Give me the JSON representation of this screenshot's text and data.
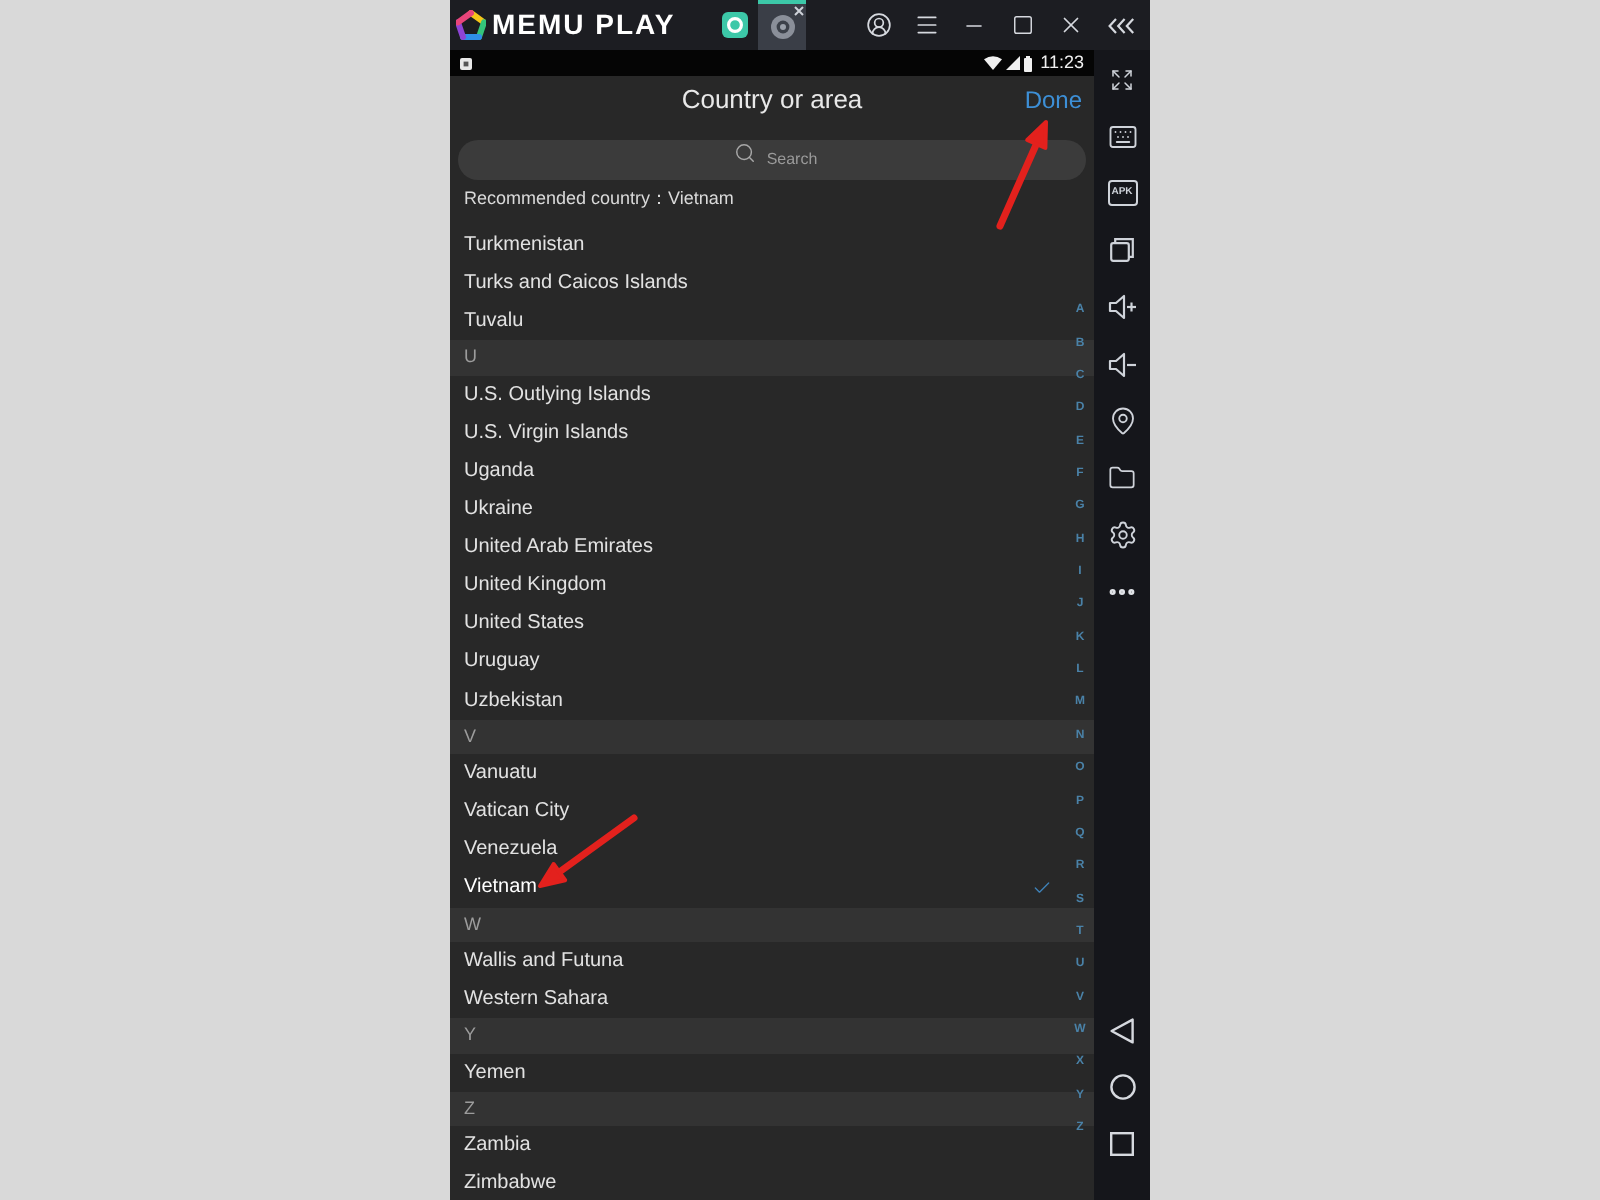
{
  "emulator": {
    "logo": "MEMU PLAY",
    "tabs": [
      {
        "selected": false
      },
      {
        "selected": true
      }
    ]
  },
  "status_bar": {
    "time": "11:23"
  },
  "header": {
    "title": "Country or area",
    "done": "Done"
  },
  "search": {
    "placeholder": "Search"
  },
  "recommended": "Recommended country：Vietnam",
  "list": {
    "rows": [
      {
        "kind": "item",
        "label": "Turkmenistan",
        "selected": false
      },
      {
        "kind": "item",
        "label": "Turks and Caicos Islands",
        "selected": false
      },
      {
        "kind": "item",
        "label": "Tuvalu",
        "selected": false
      },
      {
        "kind": "header",
        "label": "U"
      },
      {
        "kind": "item",
        "label": "U.S. Outlying Islands",
        "selected": false
      },
      {
        "kind": "item",
        "label": "U.S. Virgin Islands",
        "selected": false
      },
      {
        "kind": "item",
        "label": "Uganda",
        "selected": false
      },
      {
        "kind": "item",
        "label": "Ukraine",
        "selected": false
      },
      {
        "kind": "item",
        "label": "United Arab Emirates",
        "selected": false
      },
      {
        "kind": "item",
        "label": "United Kingdom",
        "selected": false
      },
      {
        "kind": "item",
        "label": "United States",
        "selected": false
      },
      {
        "kind": "item",
        "label": "Uruguay",
        "selected": false
      },
      {
        "kind": "item",
        "label": "Uzbekistan",
        "selected": false
      },
      {
        "kind": "header",
        "label": "V"
      },
      {
        "kind": "item",
        "label": "Vanuatu",
        "selected": false
      },
      {
        "kind": "item",
        "label": "Vatican City",
        "selected": false
      },
      {
        "kind": "item",
        "label": "Venezuela",
        "selected": false
      },
      {
        "kind": "item",
        "label": "Vietnam",
        "selected": true
      },
      {
        "kind": "header",
        "label": "W"
      },
      {
        "kind": "item",
        "label": "Wallis and Futuna",
        "selected": false
      },
      {
        "kind": "item",
        "label": "Western Sahara",
        "selected": false
      },
      {
        "kind": "header",
        "label": "Y"
      },
      {
        "kind": "item",
        "label": "Yemen",
        "selected": false
      },
      {
        "kind": "header",
        "label": "Z"
      },
      {
        "kind": "item",
        "label": "Zambia",
        "selected": false
      },
      {
        "kind": "item",
        "label": "Zimbabwe",
        "selected": false
      }
    ]
  },
  "index": [
    "A",
    "B",
    "C",
    "D",
    "E",
    "F",
    "G",
    "H",
    "I",
    "J",
    "K",
    "L",
    "M",
    "N",
    "O",
    "P",
    "Q",
    "R",
    "S",
    "T",
    "U",
    "V",
    "W",
    "X",
    "Y",
    "Z"
  ],
  "sidebar": {
    "apk_label": "APK"
  }
}
